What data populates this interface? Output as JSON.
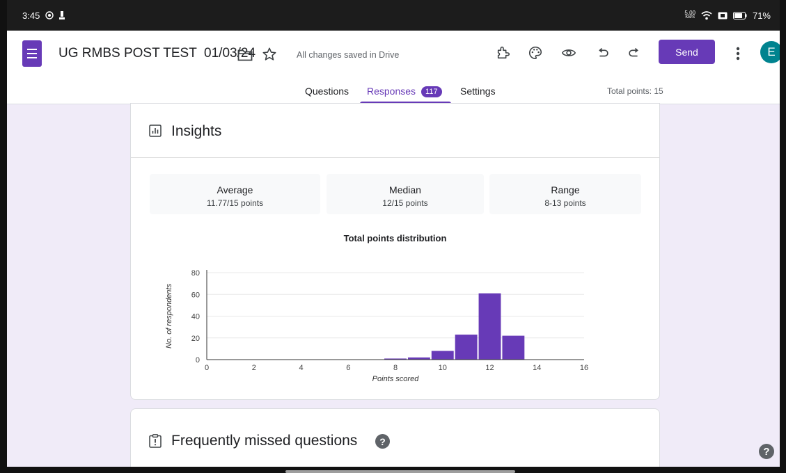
{
  "status_bar": {
    "time": "3:45",
    "speed_top": "5.00",
    "speed_unit": "KB/S",
    "battery": "71%"
  },
  "header": {
    "title": "UG RMBS POST TEST  01/03/24",
    "saved_status": "All changes saved in Drive",
    "send_label": "Send",
    "avatar_initial": "E",
    "toolbar_icons": [
      "addon-icon",
      "palette-icon",
      "preview-eye-icon",
      "undo-icon",
      "redo-icon",
      "more-vert-icon"
    ]
  },
  "tabs": [
    {
      "label": "Questions",
      "active": false
    },
    {
      "label": "Responses",
      "active": true,
      "badge": "117"
    },
    {
      "label": "Settings",
      "active": false
    }
  ],
  "total_points": "Total points: 15",
  "insights": {
    "title": "Insights",
    "stats": [
      {
        "label": "Average",
        "value": "11.77/15 points"
      },
      {
        "label": "Median",
        "value": "12/15 points"
      },
      {
        "label": "Range",
        "value": "8-13 points"
      }
    ]
  },
  "chart_data": {
    "type": "bar",
    "title": "Total points distribution",
    "xlabel": "Points scored",
    "ylabel": "No. of respondents",
    "xlim": [
      0,
      16
    ],
    "ylim": [
      0,
      80
    ],
    "xticks": [
      0,
      2,
      4,
      6,
      8,
      10,
      12,
      14,
      16
    ],
    "yticks": [
      0,
      20,
      40,
      60,
      80
    ],
    "grid": true,
    "color": "#673ab7",
    "bins": [
      {
        "x": 8,
        "value": 1
      },
      {
        "x": 9,
        "value": 2
      },
      {
        "x": 10,
        "value": 8
      },
      {
        "x": 11,
        "value": 23
      },
      {
        "x": 12,
        "value": 61
      },
      {
        "x": 13,
        "value": 22
      }
    ]
  },
  "missed": {
    "title": "Frequently missed questions",
    "help_glyph": "?"
  },
  "help_fab_glyph": "?",
  "colors": {
    "accent": "#673ab7",
    "background": "#f0ebf8",
    "avatar": "#00838f"
  }
}
